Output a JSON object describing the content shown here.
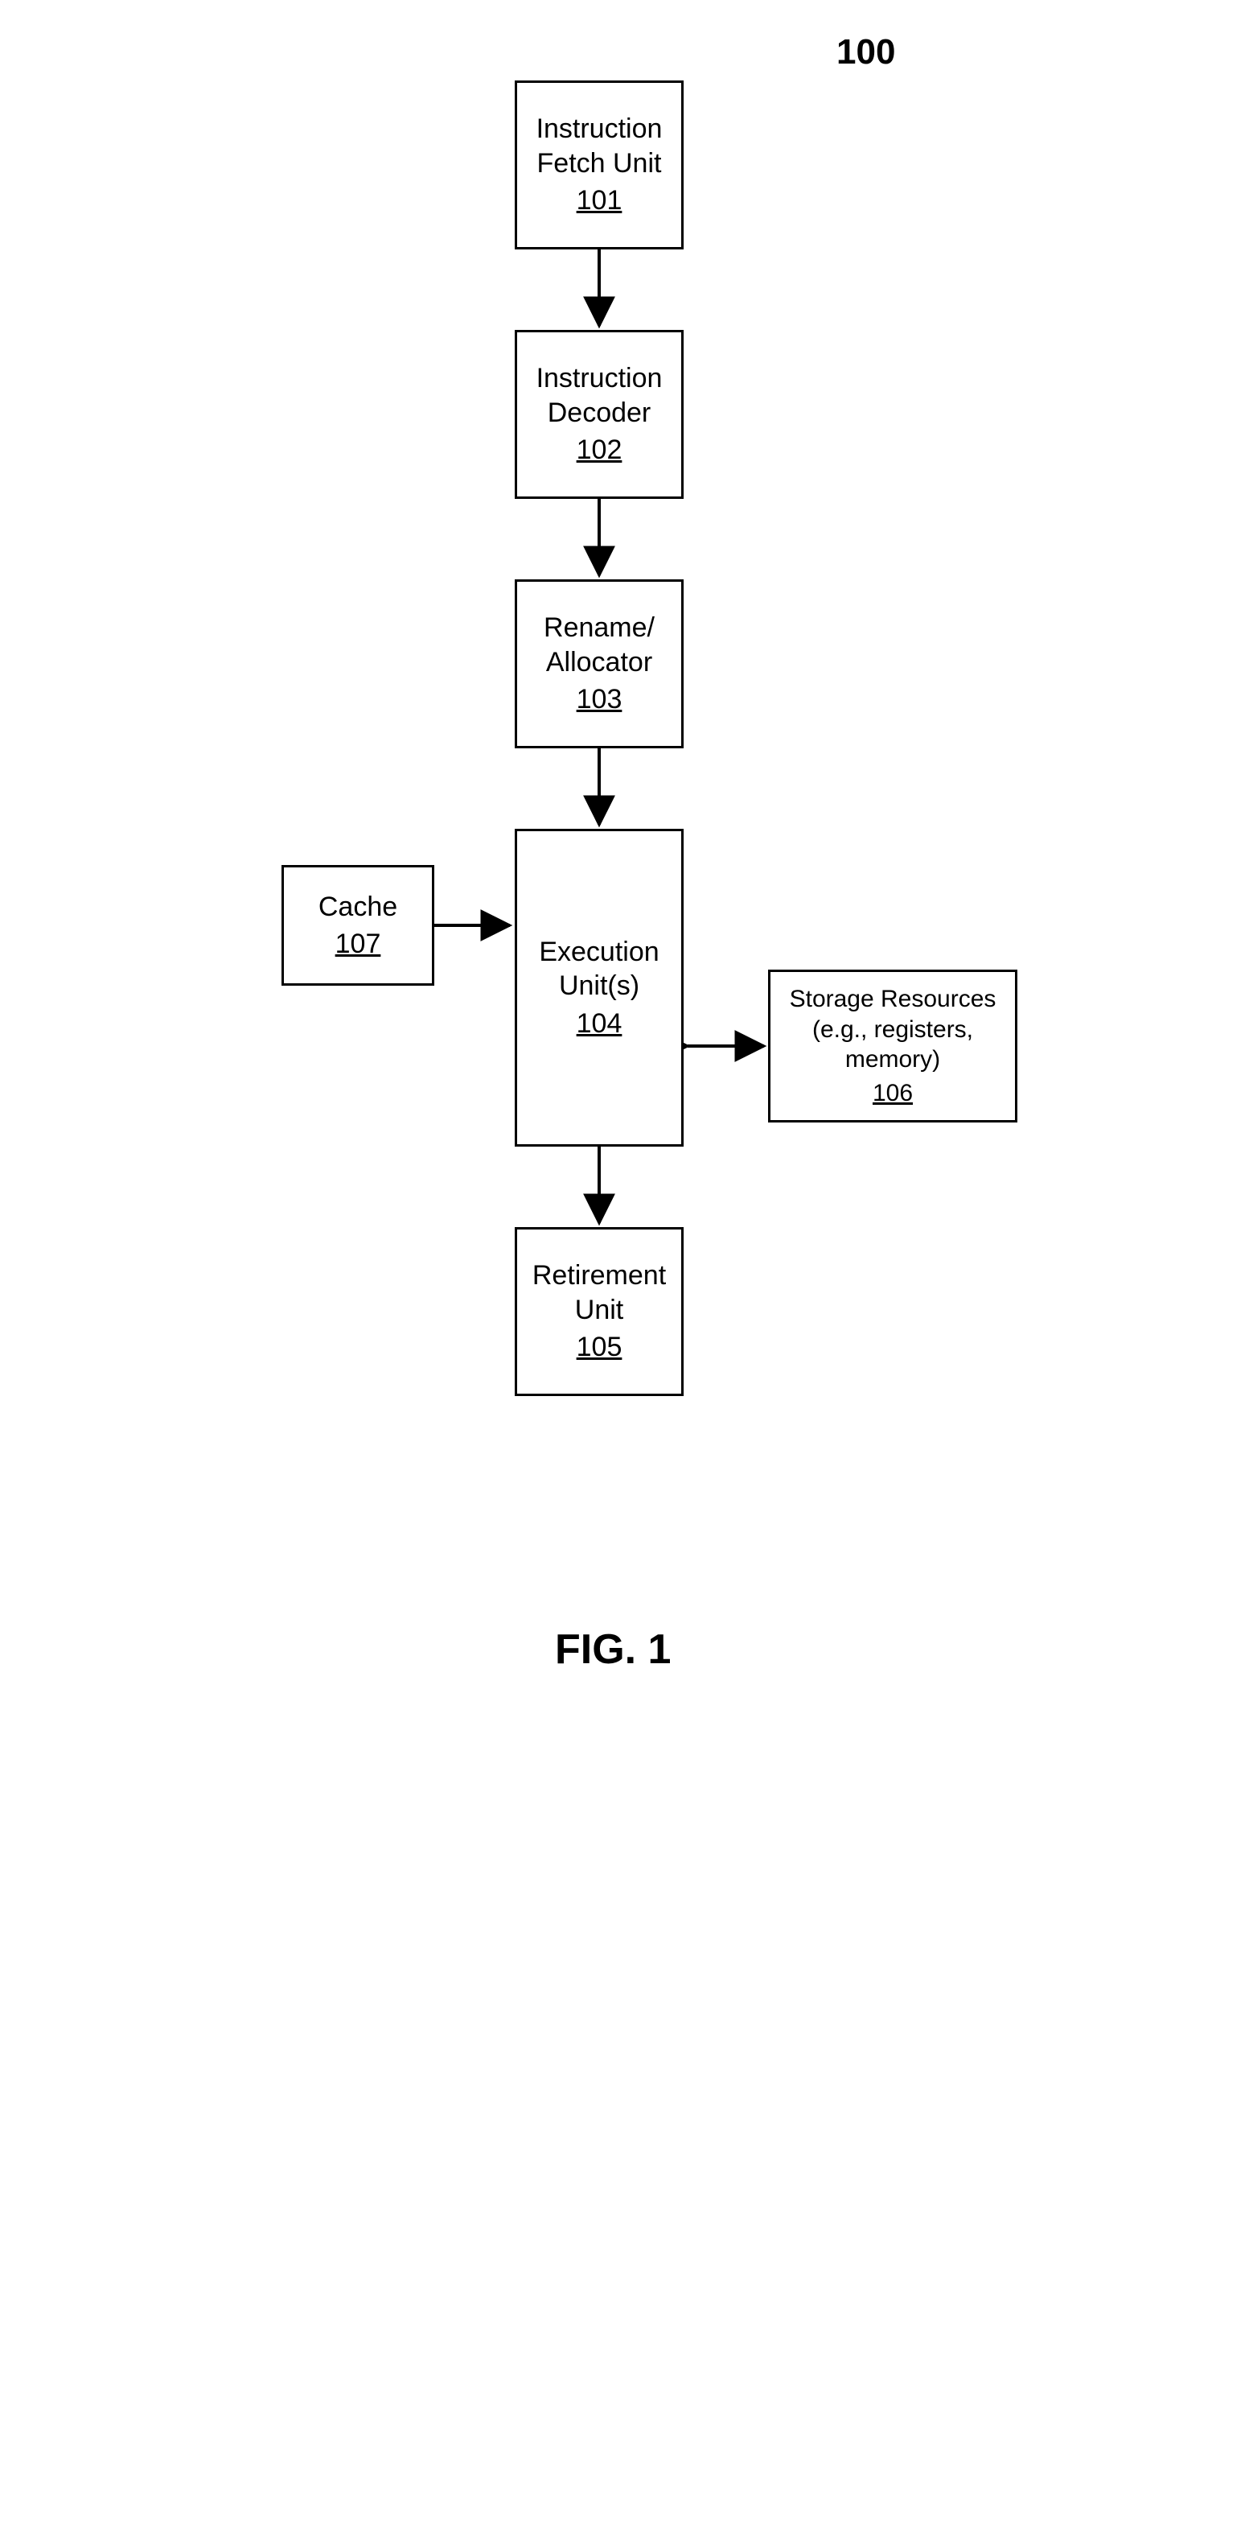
{
  "figure_label": "FIG. 1",
  "figure_ref": "100",
  "boxes": {
    "fetch": {
      "id": "101",
      "title_l1": "Instruction",
      "title_l2": "Fetch Unit"
    },
    "decoder": {
      "id": "102",
      "title_l1": "Instruction",
      "title_l2": "Decoder"
    },
    "rename": {
      "id": "103",
      "title_l1": "Rename/",
      "title_l2": "Allocator"
    },
    "exec": {
      "id": "104",
      "title": "Execution Unit(s)"
    },
    "retire": {
      "id": "105",
      "title_l1": "Retirement",
      "title_l2": "Unit"
    },
    "cache": {
      "id": "107",
      "title": "Cache"
    },
    "storage": {
      "id": "106",
      "title_l1": "Storage Resources",
      "title_l2": "(e.g., registers, memory)"
    }
  }
}
